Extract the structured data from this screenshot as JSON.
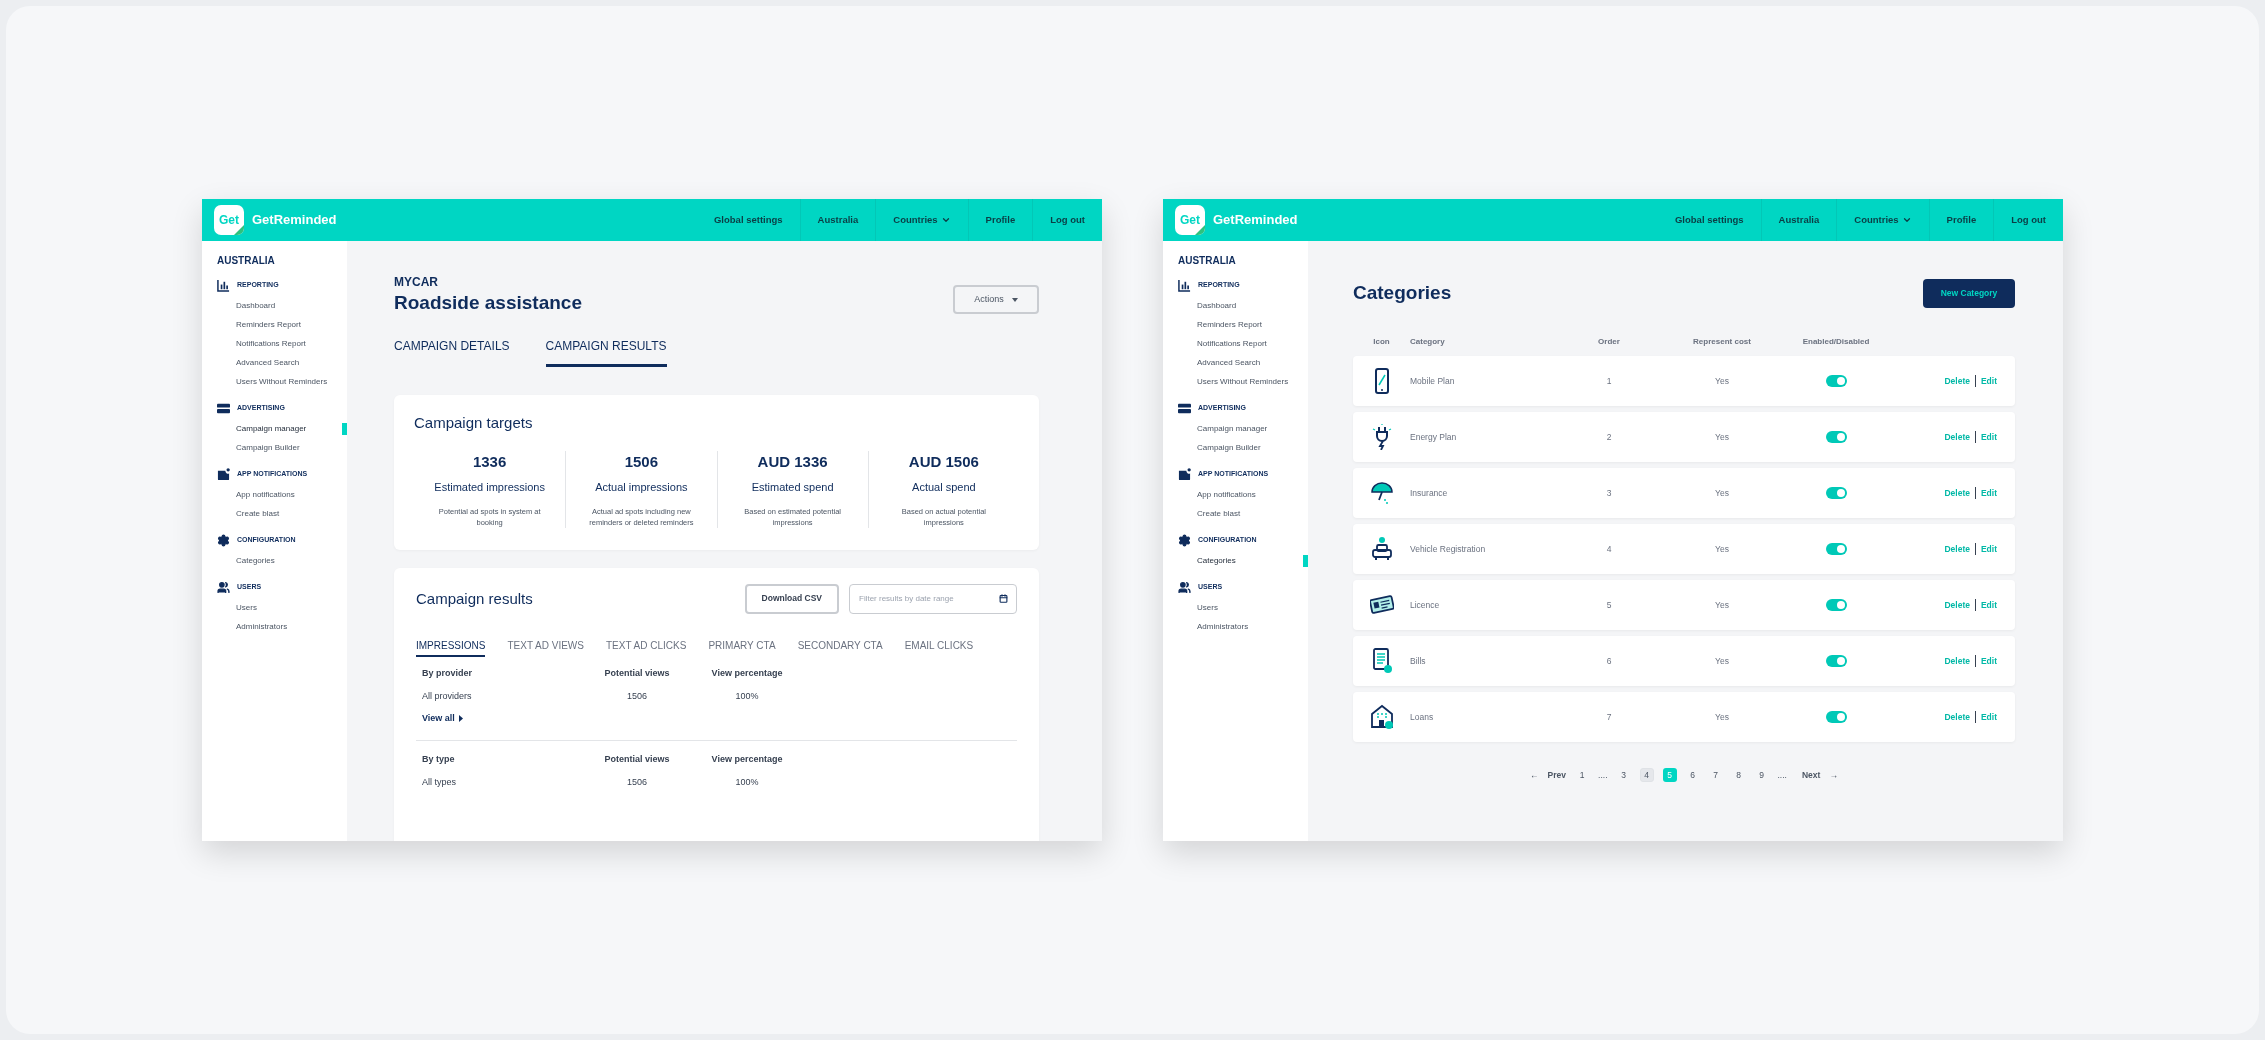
{
  "screens": [
    {
      "kind": "campaign",
      "header": {
        "logo_text": "Get",
        "brand": "GetReminded",
        "nav": [
          {
            "label": "Global settings",
            "dropdown": false
          },
          {
            "label": "Australia",
            "dropdown": false
          },
          {
            "label": "Countries",
            "dropdown": true
          },
          {
            "label": "Profile",
            "dropdown": false
          },
          {
            "label": "Log out",
            "dropdown": false
          }
        ]
      },
      "sidebar": {
        "country": "AUSTRALIA",
        "sections": [
          {
            "title": "REPORTING",
            "items": [
              {
                "label": "Dashboard",
                "selected": false
              },
              {
                "label": "Reminders Report",
                "selected": false
              },
              {
                "label": "Notifications Report",
                "selected": false
              },
              {
                "label": "Advanced Search",
                "selected": false
              },
              {
                "label": "Users Without Reminders",
                "selected": false
              }
            ]
          },
          {
            "title": "ADVERTISING",
            "items": [
              {
                "label": "Campaign manager",
                "selected": true
              },
              {
                "label": "Campaign Builder",
                "selected": false
              }
            ]
          },
          {
            "title": "APP NOTIFICATIONS",
            "items": [
              {
                "label": "App notifications",
                "selected": false
              },
              {
                "label": "Create blast",
                "selected": false
              }
            ]
          },
          {
            "title": "CONFIGURATION",
            "items": [
              {
                "label": "Categories",
                "selected": false
              }
            ]
          },
          {
            "title": "USERS",
            "items": [
              {
                "label": "Users",
                "selected": false
              },
              {
                "label": "Administrators",
                "selected": false
              }
            ]
          }
        ]
      },
      "campaign": {
        "brand": "MYCAR",
        "title": "Roadside assistance",
        "actions": "Actions",
        "tabs": [
          {
            "label": "CAMPAIGN DETAILS",
            "selected": false
          },
          {
            "label": "CAMPAIGN RESULTS",
            "selected": true
          }
        ],
        "targets": {
          "title": "Campaign targets",
          "stats": [
            {
              "value": "1336",
              "label": "Estimated impressions",
              "note": "Potential ad spots in system at booking"
            },
            {
              "value": "1506",
              "label": "Actual impressions",
              "note": "Actual ad spots including new reminders or deleted reminders"
            },
            {
              "value": "AUD 1336",
              "label": "Estimated spend",
              "note": "Based on estimated potential impressions"
            },
            {
              "value": "AUD 1506",
              "label": "Actual spend",
              "note": "Based on actual potential impressions"
            }
          ]
        },
        "results": {
          "title": "Campaign results",
          "download": "Download CSV",
          "filter_placeholder": "Filter results by date range",
          "tabs": [
            {
              "label": "IMPRESSIONS",
              "selected": true
            },
            {
              "label": "TEXT AD VIEWS",
              "selected": false
            },
            {
              "label": "TEXT AD CLICKS",
              "selected": false
            },
            {
              "label": "PRIMARY CTA",
              "selected": false
            },
            {
              "label": "SECONDARY CTA",
              "selected": false
            },
            {
              "label": "EMAIL CLICKS",
              "selected": false
            }
          ],
          "groups": [
            {
              "columns": [
                "By provider",
                "Potential views",
                "View percentage"
              ],
              "rows": [
                [
                  "All providers",
                  "1506",
                  "100%"
                ]
              ],
              "link": "View all"
            },
            {
              "columns": [
                "By type",
                "Potential views",
                "View percentage"
              ],
              "rows": [
                [
                  "All types",
                  "1506",
                  "100%"
                ]
              ]
            }
          ]
        }
      }
    },
    {
      "kind": "categories",
      "header": {
        "logo_text": "Get",
        "brand": "GetReminded",
        "nav": [
          {
            "label": "Global settings",
            "dropdown": false
          },
          {
            "label": "Australia",
            "dropdown": false
          },
          {
            "label": "Countries",
            "dropdown": true
          },
          {
            "label": "Profile",
            "dropdown": false
          },
          {
            "label": "Log out",
            "dropdown": false
          }
        ]
      },
      "sidebar": {
        "country": "AUSTRALIA",
        "sections": [
          {
            "title": "REPORTING",
            "items": [
              {
                "label": "Dashboard",
                "selected": false
              },
              {
                "label": "Reminders Report",
                "selected": false
              },
              {
                "label": "Notifications Report",
                "selected": false
              },
              {
                "label": "Advanced Search",
                "selected": false
              },
              {
                "label": "Users Without Reminders",
                "selected": false
              }
            ]
          },
          {
            "title": "ADVERTISING",
            "items": [
              {
                "label": "Campaign manager",
                "selected": false
              },
              {
                "label": "Campaign Builder",
                "selected": false
              }
            ]
          },
          {
            "title": "APP NOTIFICATIONS",
            "items": [
              {
                "label": "App notifications",
                "selected": false
              },
              {
                "label": "Create blast",
                "selected": false
              }
            ]
          },
          {
            "title": "CONFIGURATION",
            "items": [
              {
                "label": "Categories",
                "selected": true
              }
            ]
          },
          {
            "title": "USERS",
            "items": [
              {
                "label": "Users",
                "selected": false
              },
              {
                "label": "Administrators",
                "selected": false
              }
            ]
          }
        ]
      },
      "categories": {
        "title": "Categories",
        "new_button": "New Category",
        "columns": [
          "Icon",
          "Category",
          "Order",
          "Represent cost",
          "Enabled/Disabled"
        ],
        "rows": [
          {
            "name": "Mobile Plan",
            "order": "1",
            "represent_cost": "Yes",
            "on": true,
            "actions": [
              "Delete",
              "Edit"
            ]
          },
          {
            "name": "Energy Plan",
            "order": "2",
            "represent_cost": "Yes",
            "on": true,
            "actions": [
              "Delete",
              "Edit"
            ]
          },
          {
            "name": "Insurance",
            "order": "3",
            "represent_cost": "Yes",
            "on": true,
            "actions": [
              "Delete",
              "Edit"
            ]
          },
          {
            "name": "Vehicle Registration",
            "order": "4",
            "represent_cost": "Yes",
            "on": true,
            "actions": [
              "Delete",
              "Edit"
            ]
          },
          {
            "name": "Licence",
            "order": "5",
            "represent_cost": "Yes",
            "on": true,
            "actions": [
              "Delete",
              "Edit"
            ]
          },
          {
            "name": "Bills",
            "order": "6",
            "represent_cost": "Yes",
            "on": true,
            "actions": [
              "Delete",
              "Edit"
            ]
          },
          {
            "name": "Loans",
            "order": "7",
            "represent_cost": "Yes",
            "on": true,
            "actions": [
              "Delete",
              "Edit"
            ]
          }
        ],
        "pagination": {
          "prev": {
            "arrow": "←",
            "label": "Prev"
          },
          "next": {
            "label": "Next",
            "arrow": "→"
          },
          "pages": [
            {
              "kind": "page",
              "label": "1",
              "selected": false,
              "highlighted": false
            },
            {
              "kind": "ellipsis",
              "label": "...."
            },
            {
              "kind": "page",
              "label": "3",
              "selected": false,
              "highlighted": false
            },
            {
              "kind": "page",
              "label": "4",
              "selected": false,
              "highlighted": true
            },
            {
              "kind": "page",
              "label": "5",
              "selected": true,
              "highlighted": false
            },
            {
              "kind": "page",
              "label": "6",
              "selected": false,
              "highlighted": false
            },
            {
              "kind": "page",
              "label": "7",
              "selected": false,
              "highlighted": false
            },
            {
              "kind": "page",
              "label": "8",
              "selected": false,
              "highlighted": false
            },
            {
              "kind": "page",
              "label": "9",
              "selected": false,
              "highlighted": false
            },
            {
              "kind": "ellipsis",
              "label": "...."
            }
          ]
        }
      }
    }
  ]
}
